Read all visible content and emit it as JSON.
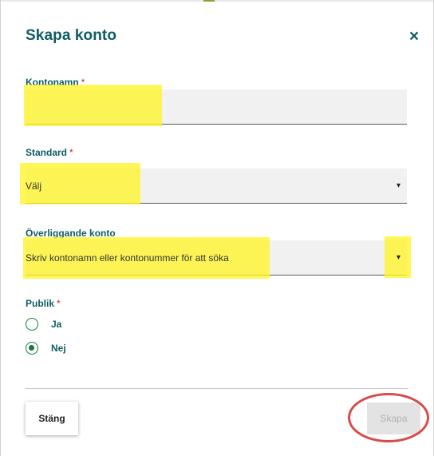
{
  "dialog": {
    "title": "Skapa konto",
    "close_glyph": "×"
  },
  "fields": {
    "kontonamn": {
      "label": "Kontonamn",
      "required_mark": "*",
      "value": ""
    },
    "standard": {
      "label": "Standard",
      "required_mark": "*",
      "selected": "Välj",
      "arrow_glyph": "▾"
    },
    "overliggande_konto": {
      "label": "Överliggande konto",
      "placeholder": "Skriv kontonamn eller kontonummer för att söka",
      "arrow_glyph": "▾"
    },
    "publik": {
      "label": "Publik",
      "required_mark": "*",
      "options": [
        {
          "label": "Ja",
          "checked": false
        },
        {
          "label": "Nej",
          "checked": true
        }
      ]
    }
  },
  "footer": {
    "close_label": "Stäng",
    "create_label": "Skapa"
  },
  "colors": {
    "heading": "#0d5c63",
    "required": "#c62828",
    "radio": "#137a3b",
    "highlight": "#fff528",
    "annotation_circle": "#d94a4a"
  },
  "icons": {
    "close": "close-icon",
    "dropdown": "chevron-down-icon",
    "radio_unchecked": "radio-unchecked-icon",
    "radio_checked": "radio-checked-icon"
  }
}
